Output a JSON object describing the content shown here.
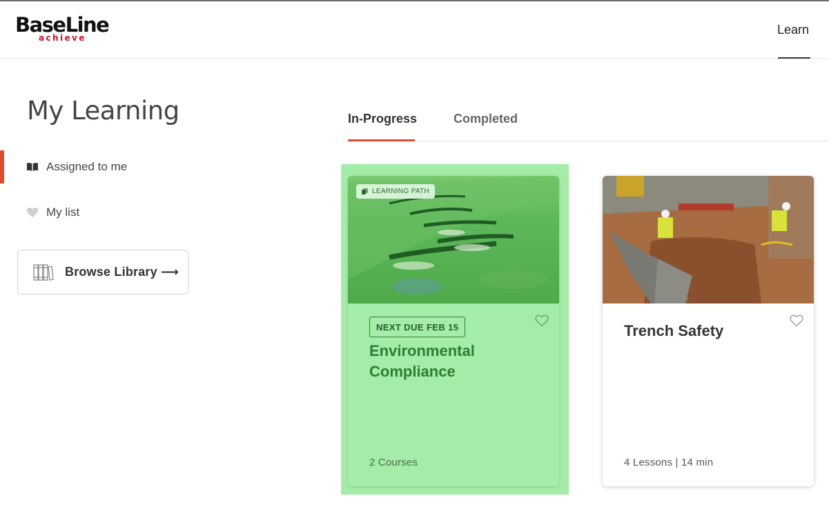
{
  "header": {
    "logo_main": "BaseLine",
    "logo_sub": "achieve",
    "nav_learn": "Learn"
  },
  "sidebar": {
    "title": "My Learning",
    "items": [
      {
        "label": "Assigned to me",
        "icon": "open-book-icon",
        "active": true
      },
      {
        "label": "My list",
        "icon": "heart-icon",
        "active": false
      }
    ],
    "browse_button": {
      "label": "Browse Library ⟶",
      "icon": "library-books-icon"
    }
  },
  "tabs": [
    {
      "label": "In-Progress",
      "active": true
    },
    {
      "label": "Completed",
      "active": false
    }
  ],
  "cards": [
    {
      "badge": "LEARNING PATH",
      "due": "NEXT DUE FEB 15",
      "title": "Environmental Compliance",
      "meta": "2 Courses",
      "image": "grass-slope-silt-fence-photo"
    },
    {
      "title": "Trench Safety",
      "meta": "4 Lessons | 14 min",
      "image": "trench-excavation-photo"
    }
  ],
  "colors": {
    "accent": "#e04a2f",
    "highlight": "#a4eca8",
    "path_title": "#2e7d32",
    "logo_red": "#c8102e"
  }
}
